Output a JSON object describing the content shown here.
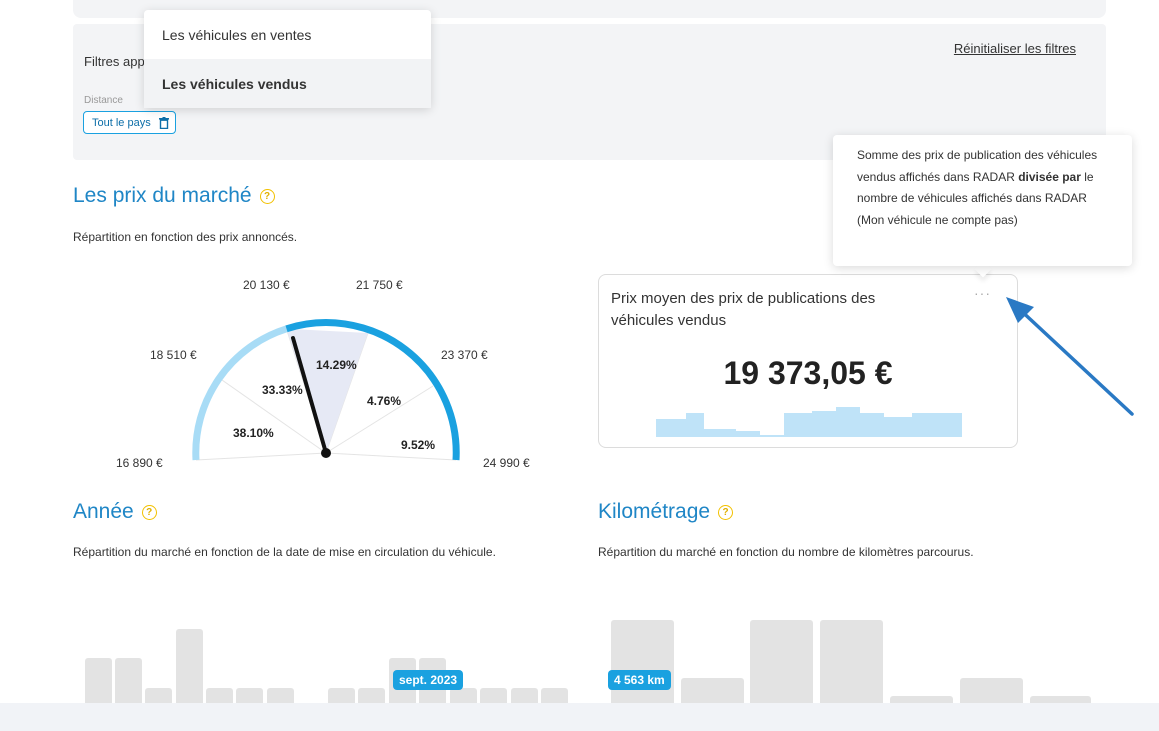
{
  "filters": {
    "label": "Filtres appliqués",
    "reset_label": "Réinitialiser les filtres",
    "distance_label": "Distance",
    "distance_chip": "Tout le pays"
  },
  "dropdown": {
    "items": [
      {
        "label": "Les véhicules en ventes",
        "selected": false
      },
      {
        "label": "Les véhicules vendus",
        "selected": true
      }
    ]
  },
  "prix_marche": {
    "title": "Les prix du marché",
    "subtitle": "Répartition en fonction des prix annoncés.",
    "gauge": {
      "boundaries": [
        "16 890 €",
        "18 510 €",
        "20 130 €",
        "21 750 €",
        "23 370 €",
        "24 990 €"
      ],
      "segments": [
        {
          "label": "38.10%",
          "value": 38.1
        },
        {
          "label": "33.33%",
          "value": 33.33
        },
        {
          "label": "14.29%",
          "value": 14.29
        },
        {
          "label": "4.76%",
          "value": 4.76
        },
        {
          "label": "9.52%",
          "value": 9.52
        }
      ],
      "colors": {
        "light": "#a8dcf6",
        "dark": "#1aa1e0",
        "highlight": "#e6e9f5",
        "needle": "#111111"
      }
    }
  },
  "avg_card": {
    "title": "Prix moyen des prix de publications des véhicules vendus",
    "menu": "···",
    "value": "19 373,05 €"
  },
  "tooltip": {
    "text_before": "Somme des prix de publication des véhicules vendus affichés dans RADAR ",
    "text_bold": "divisée par",
    "text_after": " le nombre de véhicules affichés dans RADAR (Mon véhicule ne compte pas)"
  },
  "annee": {
    "title": "Année",
    "subtitle": "Répartition du marché en fonction de la date de mise en circulation du véhicule.",
    "badge": "sept. 2023"
  },
  "kilometrage": {
    "title": "Kilométrage",
    "subtitle": "Répartition du marché en fonction du nombre de kilomètres parcourus.",
    "badge": "4 563 km"
  },
  "colors": {
    "accent": "#1aa1e0",
    "title_blue": "#1f86c6",
    "help_yellow": "#f2c100"
  }
}
